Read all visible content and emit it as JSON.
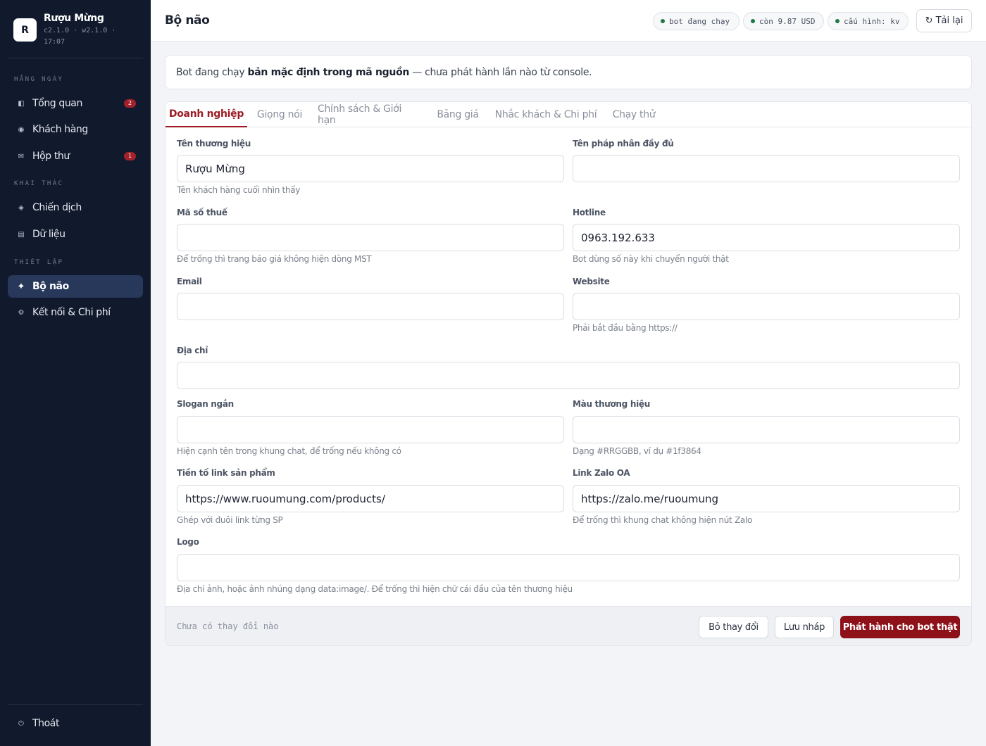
{
  "sidebar": {
    "brand_initial": "R",
    "brand_name": "Rượu Mừng",
    "version": "c2.1.0 · w2.1.0 · 17:07",
    "sections": {
      "daily": "HẰNG NGÀY",
      "exploit": "KHAI THÁC",
      "setup": "THIẾT LẬP"
    },
    "items": [
      {
        "label": "Tổng quan",
        "badge": "2",
        "icon": "overview-icon"
      },
      {
        "label": "Khách hàng",
        "icon": "customers-icon"
      },
      {
        "label": "Hộp thư",
        "badge": "1",
        "icon": "mail-icon"
      },
      {
        "label": "Chiến dịch",
        "icon": "campaign-icon"
      },
      {
        "label": "Dữ liệu",
        "icon": "data-icon"
      },
      {
        "label": "Bộ não",
        "icon": "sparkle-icon",
        "active": true
      },
      {
        "label": "Kết nối & Chi phí",
        "icon": "gear-icon"
      }
    ],
    "logout": "Thoát"
  },
  "header": {
    "title": "Bộ não",
    "pills": [
      "bot đang chạy",
      "còn 9.87 USD",
      "cấu hình: kv"
    ],
    "reload": "↻ Tải lại"
  },
  "notice": {
    "before": "Bot đang chạy ",
    "bold": "bản mặc định trong mã nguồn",
    "after": " — chưa phát hành lần nào từ console."
  },
  "tabs": [
    "Doanh nghiệp",
    "Giọng nói",
    "Chính sách & Giới hạn",
    "Bảng giá",
    "Nhắc khách & Chi phí",
    "Chạy thử"
  ],
  "form": {
    "brand_name": {
      "label": "Tên thương hiệu",
      "value": "Rượu Mừng",
      "hint": "Tên khách hàng cuối nhìn thấy"
    },
    "legal_name": {
      "label": "Tên pháp nhân đầy đủ",
      "value": ""
    },
    "tax_id": {
      "label": "Mã số thuế",
      "value": "",
      "hint": "Để trống thì trang báo giá không hiện dòng MST"
    },
    "hotline": {
      "label": "Hotline",
      "value": "0963.192.633",
      "hint": "Bot dùng số này khi chuyển người thật"
    },
    "email": {
      "label": "Email",
      "value": ""
    },
    "website": {
      "label": "Website",
      "value": "",
      "hint": "Phải bắt đầu bằng https://"
    },
    "address": {
      "label": "Địa chỉ",
      "value": ""
    },
    "slogan": {
      "label": "Slogan ngắn",
      "value": "",
      "hint": "Hiện cạnh tên trong khung chat, để trống nếu không có"
    },
    "brand_color": {
      "label": "Màu thương hiệu",
      "value": "",
      "hint": "Dạng #RRGGBB, ví dụ #1f3864"
    },
    "product_prefix": {
      "label": "Tiền tố link sản phẩm",
      "value": "https://www.ruoumung.com/products/",
      "hint": "Ghép với đuôi link từng SP"
    },
    "zalo_oa": {
      "label": "Link Zalo OA",
      "value": "https://zalo.me/ruoumung",
      "hint": "Để trống thì khung chat không hiện nút Zalo"
    },
    "logo": {
      "label": "Logo",
      "value": "",
      "hint": "Địa chỉ ảnh, hoặc ảnh nhúng dạng data:image/. Để trống thì hiện chữ cái đầu của tên thương hiệu"
    }
  },
  "footer": {
    "status": "Chưa có thay đổi nào",
    "discard": "Bỏ thay đổi",
    "save_draft": "Lưu nháp",
    "publish": "Phát hành cho bot thật"
  },
  "colors": {
    "sidebar_bg": "#111a2d",
    "accent": "#8e1019",
    "status_green": "#1f7a44"
  }
}
